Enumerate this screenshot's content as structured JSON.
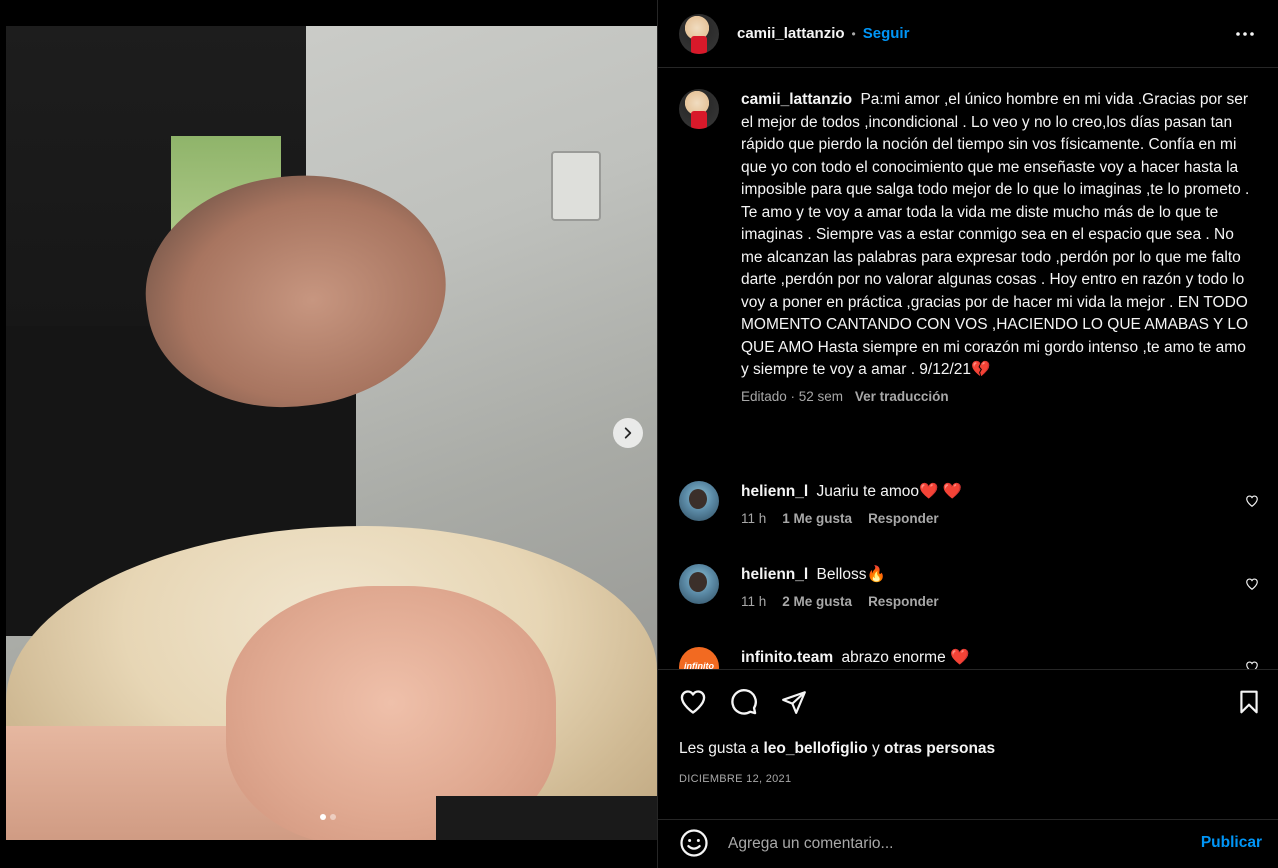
{
  "post": {
    "slide_count": 2,
    "active_slide": 1
  },
  "header": {
    "username": "camii_lattanzio",
    "separator": "•",
    "follow_label": "Seguir"
  },
  "caption": {
    "username": "camii_lattanzio",
    "text": "Pa:mi amor ,el único hombre en mi vida .Gracias por ser el mejor de todos ,incondicional . Lo veo y no lo creo,los días pasan tan rápido que pierdo la noción del tiempo sin vos físicamente. Confía en mi que yo con todo el conocimiento que me enseñaste voy a hacer hasta la imposible para que salga todo mejor de lo que lo imaginas ,te lo prometo . Te amo y te voy a amar toda la vida me diste mucho más de lo que te imaginas . Siempre vas a estar conmigo sea en el espacio que sea . No me alcanzan las palabras para expresar todo ,perdón por lo que me falto darte ,perdón por no valorar algunas cosas . Hoy entro en razón y todo lo voy a poner en práctica ,gracias por de hacer mi vida la mejor . EN TODO MOMENTO CANTANDO CON VOS ,HACIENDO LO QUE AMABAS Y LO QUE AMO Hasta siempre en mi corazón mi gordo intenso ,te amo te amo y siempre te voy a amar . 9/12/21💔",
    "meta": "Editado · 52 sem",
    "translate_label": "Ver traducción"
  },
  "comments": [
    {
      "username": "helienn_l",
      "text": "Juariu te amoo❤️ ❤️",
      "time": "11 h",
      "likes": "1 Me gusta",
      "reply_label": "Responder",
      "avatar_icon": "user-avatar"
    },
    {
      "username": "helienn_l",
      "text": "Belloss🔥",
      "time": "11 h",
      "likes": "2 Me gusta",
      "reply_label": "Responder",
      "avatar_icon": "user-avatar"
    },
    {
      "username": "infinito.team",
      "text": "abrazo enorme ❤️",
      "avatar_text": "infinito",
      "avatar_icon": "brand-avatar"
    }
  ],
  "actions": {
    "like_icon": "heart-icon",
    "comment_icon": "speech-bubble-icon",
    "share_icon": "paper-plane-icon",
    "save_icon": "bookmark-icon"
  },
  "likes": {
    "prefix": "Les gusta a",
    "user": "leo_bellofiglio",
    "joiner": "y",
    "others": "otras personas"
  },
  "date": "DICIEMBRE 12, 2021",
  "composer": {
    "placeholder": "Agrega un comentario...",
    "publish_label": "Publicar"
  },
  "colors": {
    "accent": "#0095f6",
    "background": "#000000",
    "border": "#262626",
    "muted_text": "#a8a8a8"
  }
}
